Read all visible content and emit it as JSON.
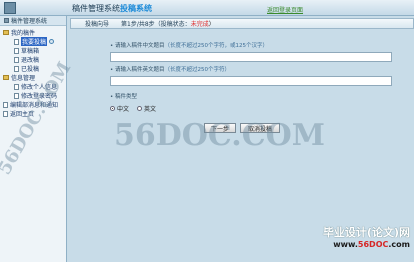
{
  "header": {
    "title_prefix": "稿件管理系统",
    "title_highlight": "投稿系统",
    "link": "返回登录页面"
  },
  "sidebar": {
    "title": "稿件管理系统",
    "groups": [
      {
        "label": "我的稿件",
        "items": [
          "我要投稿",
          "草稿箱",
          "退改稿",
          "已投稿"
        ]
      },
      {
        "label": "信息管理",
        "items": [
          "修改个人信息",
          "修改登录密码"
        ]
      }
    ],
    "extra_items": [
      "编辑部消息和通知",
      "返回主页"
    ],
    "active_item": "我要投稿"
  },
  "breadcrumb": {
    "tab": "投稿向导",
    "step": "第1步/共8步（投稿状态：",
    "status": "未完成",
    "close": "）"
  },
  "form": {
    "title_cn_label": "• 请输入稿件中文题目",
    "title_cn_hint": "（长度不超过250个字符，或125个汉字）",
    "title_cn_value": "",
    "title_en_label": "• 请输入稿件英文题目",
    "title_en_hint": "（长度不超过250个字符）",
    "title_en_value": "",
    "type_label": "• 稿件类型",
    "type_options": [
      "中文",
      "英文"
    ],
    "type_selected": "中文",
    "next_button": "下一步",
    "cancel_button": "取消投稿"
  },
  "watermarks": {
    "center": "56DOC.COM",
    "side": "56DOC.COM",
    "footer_line1": "毕业设计(论文)网",
    "footer_line2_prefix": "www.",
    "footer_line2_red": "56DOC",
    "footer_line2_suffix": ".com"
  }
}
